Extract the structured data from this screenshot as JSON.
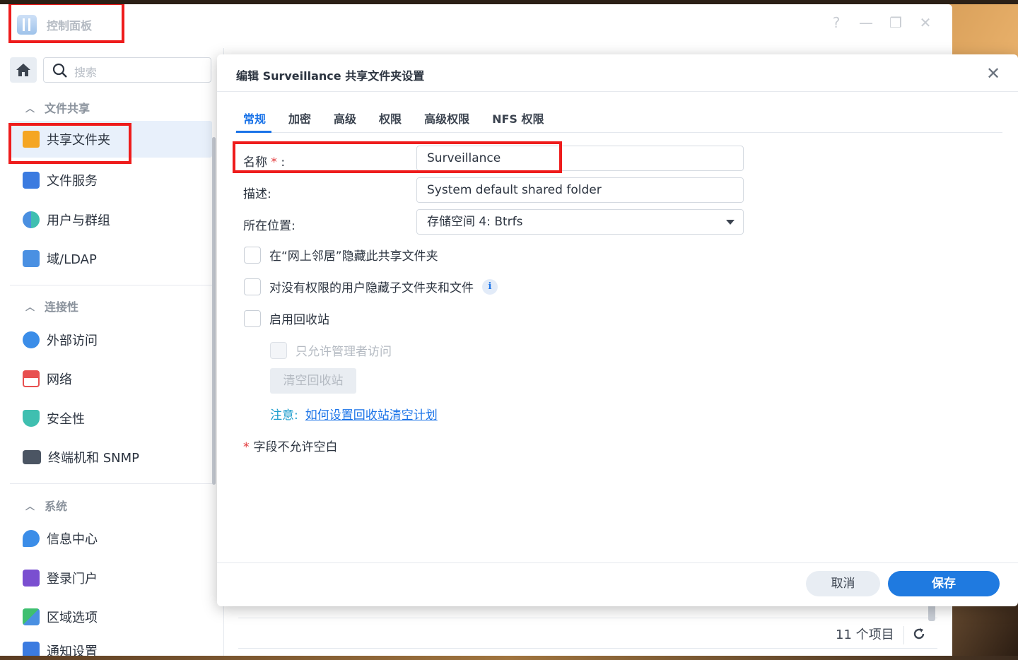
{
  "window": {
    "title": "控制面板",
    "controls": [
      "?",
      "—",
      "❐",
      "✕"
    ]
  },
  "sidebar": {
    "search_placeholder": "搜索",
    "groups": [
      {
        "title": "文件共享",
        "items": [
          {
            "label": "共享文件夹",
            "icon": "shared-folder-icon",
            "active": true
          },
          {
            "label": "文件服务",
            "icon": "file-services-icon"
          },
          {
            "label": "用户与群组",
            "icon": "users-groups-icon"
          },
          {
            "label": "域/LDAP",
            "icon": "domain-ldap-icon"
          }
        ]
      },
      {
        "title": "连接性",
        "items": [
          {
            "label": "外部访问",
            "icon": "external-access-icon"
          },
          {
            "label": "网络",
            "icon": "network-icon"
          },
          {
            "label": "安全性",
            "icon": "security-shield-icon"
          },
          {
            "label": "终端机和 SNMP",
            "icon": "terminal-icon"
          }
        ]
      },
      {
        "title": "系统",
        "items": [
          {
            "label": "信息中心",
            "icon": "info-center-icon"
          },
          {
            "label": "登录门户",
            "icon": "login-portal-icon"
          },
          {
            "label": "区域选项",
            "icon": "regional-options-icon"
          },
          {
            "label": "通知设置",
            "icon": "notification-icon"
          }
        ]
      }
    ]
  },
  "list_footer": {
    "item_count": "11 个项目"
  },
  "dialog": {
    "title": "编辑 Surveillance 共享文件夹设置",
    "tabs": [
      "常规",
      "加密",
      "高级",
      "权限",
      "高级权限",
      "NFS 权限"
    ],
    "active_tab": "常规",
    "fields": {
      "name_label": "名称",
      "name_req": "*",
      "name_colon": ":",
      "name_value": "Surveillance",
      "desc_label": "描述:",
      "desc_value": "System default shared folder",
      "location_label": "所在位置:",
      "location_value": "存储空间 4:   Btrfs"
    },
    "checkboxes": {
      "hide_network": "在“网上邻居”隐藏此共享文件夹",
      "hide_subfolders": "对没有权限的用户隐藏子文件夹和文件",
      "enable_recycle": "启用回收站",
      "admin_only": "只允许管理者访问"
    },
    "empty_recycle_label": "清空回收站",
    "note_label": "注意:",
    "note_link": "如何设置回收站清空计划",
    "required_note_star": "*",
    "required_note": "字段不允许空白",
    "cancel_label": "取消",
    "save_label": "保存"
  },
  "colors": {
    "accent": "#1a73e8",
    "highlight_box": "#ee1c1c",
    "required": "#e2383a"
  }
}
